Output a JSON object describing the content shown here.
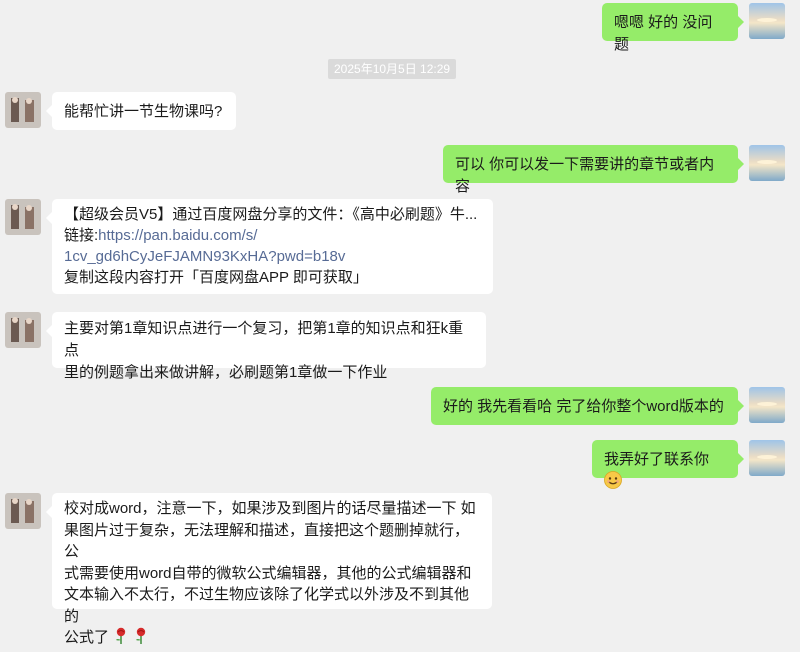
{
  "timestamp": "2025年10月5日 12:29",
  "messages": [
    {
      "side": "right",
      "text": "嗯嗯 好的 没问题"
    },
    {
      "side": "left",
      "text": "能帮忙讲一节生物课吗?"
    },
    {
      "side": "right",
      "text": "可以 你可以发一下需要讲的章节或者内容"
    },
    {
      "side": "left",
      "line1": "【超级会员V5】通过百度网盘分享的文件：《高中必刷题》牛...",
      "link_prefix": "链接:",
      "link_line1": "https://pan.baidu.com/s/",
      "link_line2": "1cv_gd6hCyJeFJAMN93KxHA?pwd=b18v",
      "line_last": "复制这段内容打开「百度网盘APP 即可获取」"
    },
    {
      "side": "left",
      "line1": "主要对第1章知识点进行一个复习，把第1章的知识点和狂k重点",
      "line2": "里的例题拿出来做讲解，必刷题第1章做一下作业"
    },
    {
      "side": "right",
      "text": "好的 我先看看哈 完了给你整个word版本的"
    },
    {
      "side": "right",
      "text": "我弄好了联系你",
      "emoji": "smiling-face-icon"
    },
    {
      "side": "left",
      "line1": "校对成word，注意一下，如果涉及到图片的话尽量描述一下 如",
      "line2": "果图片过于复杂，无法理解和描述，直接把这个题删掉就行，公",
      "line3": "式需要使用word自带的微软公式编辑器，其他的公式编辑器和",
      "line4": "文本输入不太行，不过生物应该除了化学式以外涉及不到其他的",
      "line5": "公式了",
      "emoji": "rose-icon"
    }
  ]
}
